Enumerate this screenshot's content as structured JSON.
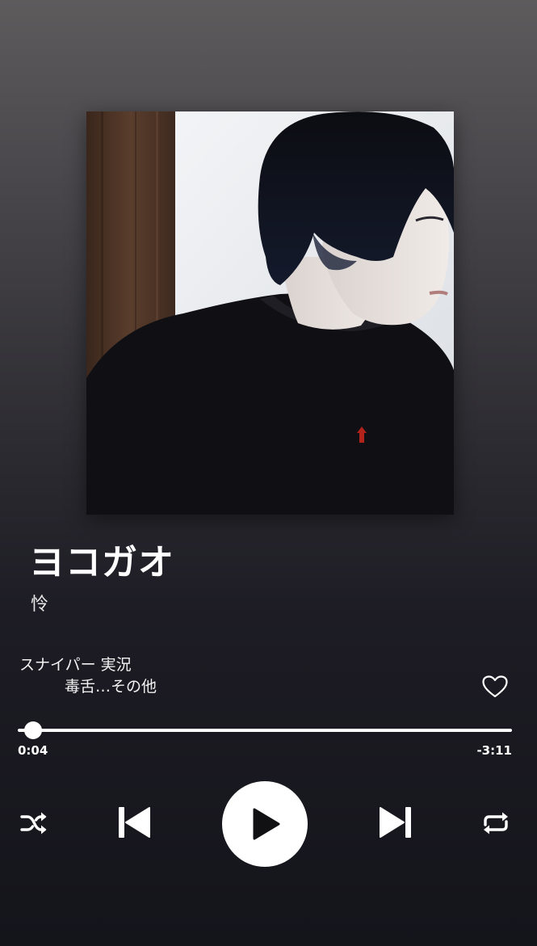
{
  "player": {
    "progress_fraction": 0.031,
    "is_playing": false
  },
  "track": {
    "title": "ヨコガオ",
    "artist": "怜",
    "context_line1": "スナイパー 実況",
    "context_line2": "毒舌…その他",
    "time_elapsed": "0:04",
    "time_remaining": "-3:11",
    "liked": false
  },
  "controls": {
    "shuffle_icon": "shuffle-icon",
    "previous_icon": "skip-previous-icon",
    "play_icon": "play-icon",
    "next_icon": "skip-next-icon",
    "repeat_icon": "repeat-icon",
    "heart_icon": "heart-outline-icon"
  },
  "colors": {
    "foreground": "#ffffff",
    "background_top": "#5d5b5c",
    "background_bottom": "#14141b"
  }
}
